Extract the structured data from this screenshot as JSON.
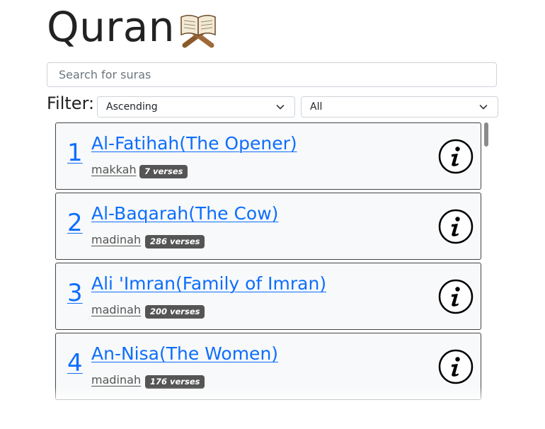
{
  "app": {
    "title": "Quran",
    "title_icon": "open-book-icon"
  },
  "search": {
    "placeholder": "Search for suras",
    "value": ""
  },
  "filter": {
    "label": "Filter:",
    "order_selected": "Ascending",
    "place_selected": "All"
  },
  "suras": [
    {
      "number": "1",
      "name": "Al-Fatihah(The Opener)",
      "place": "makkah",
      "verses": "7 verses"
    },
    {
      "number": "2",
      "name": "Al-Baqarah(The Cow)",
      "place": "madinah",
      "verses": "286 verses"
    },
    {
      "number": "3",
      "name": "Ali 'Imran(Family of Imran)",
      "place": "madinah",
      "verses": "200 verses"
    },
    {
      "number": "4",
      "name": "An-Nisa(The Women)",
      "place": "madinah",
      "verses": "176 verses"
    }
  ],
  "colors": {
    "link": "#0d6efd",
    "badge": "#555555",
    "card_bg": "#f8f9fa"
  }
}
